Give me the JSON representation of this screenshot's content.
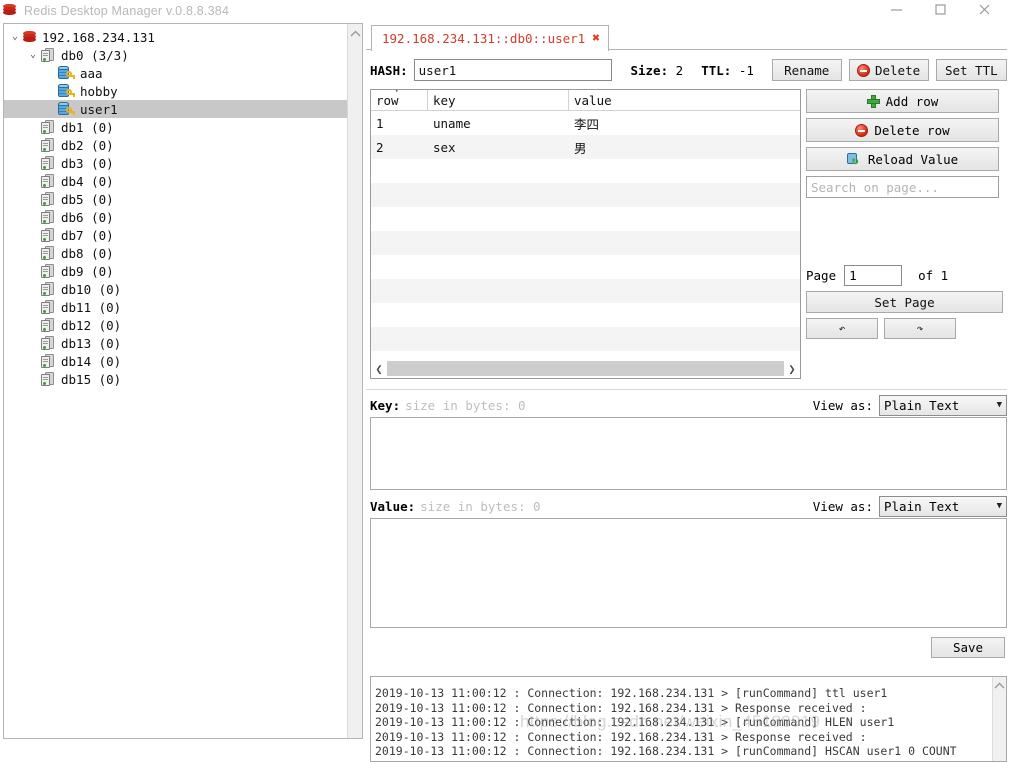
{
  "window": {
    "title": "Redis Desktop Manager v.0.8.8.384",
    "logo_icon": "redis-logo-icon",
    "controls": {
      "minimize": "minimize-icon",
      "maximize": "maximize-icon",
      "close": "close-icon"
    }
  },
  "tree": {
    "nodes": [
      {
        "label": "192.168.234.131",
        "level": 1,
        "twist": "⌄",
        "icon": "redis-server-icon",
        "selected": false
      },
      {
        "label": "db0   (3/3)",
        "level": 2,
        "twist": "⌄",
        "icon": "database-icon",
        "selected": false
      },
      {
        "label": "aaa",
        "level": 3,
        "twist": "",
        "icon": "key-icon",
        "selected": false
      },
      {
        "label": "hobby",
        "level": 3,
        "twist": "",
        "icon": "key-icon",
        "selected": false
      },
      {
        "label": "user1",
        "level": 3,
        "twist": "",
        "icon": "key-icon",
        "selected": true
      },
      {
        "label": "db1  (0)",
        "level": 2,
        "twist": "",
        "icon": "database-icon",
        "selected": false
      },
      {
        "label": "db2  (0)",
        "level": 2,
        "twist": "",
        "icon": "database-icon",
        "selected": false
      },
      {
        "label": "db3  (0)",
        "level": 2,
        "twist": "",
        "icon": "database-icon",
        "selected": false
      },
      {
        "label": "db4  (0)",
        "level": 2,
        "twist": "",
        "icon": "database-icon",
        "selected": false
      },
      {
        "label": "db5  (0)",
        "level": 2,
        "twist": "",
        "icon": "database-icon",
        "selected": false
      },
      {
        "label": "db6  (0)",
        "level": 2,
        "twist": "",
        "icon": "database-icon",
        "selected": false
      },
      {
        "label": "db7  (0)",
        "level": 2,
        "twist": "",
        "icon": "database-icon",
        "selected": false
      },
      {
        "label": "db8  (0)",
        "level": 2,
        "twist": "",
        "icon": "database-icon",
        "selected": false
      },
      {
        "label": "db9  (0)",
        "level": 2,
        "twist": "",
        "icon": "database-icon",
        "selected": false
      },
      {
        "label": "db10  (0)",
        "level": 2,
        "twist": "",
        "icon": "database-icon",
        "selected": false
      },
      {
        "label": "db11  (0)",
        "level": 2,
        "twist": "",
        "icon": "database-icon",
        "selected": false
      },
      {
        "label": "db12  (0)",
        "level": 2,
        "twist": "",
        "icon": "database-icon",
        "selected": false
      },
      {
        "label": "db13  (0)",
        "level": 2,
        "twist": "",
        "icon": "database-icon",
        "selected": false
      },
      {
        "label": "db14  (0)",
        "level": 2,
        "twist": "",
        "icon": "database-icon",
        "selected": false
      },
      {
        "label": "db15  (0)",
        "level": 2,
        "twist": "",
        "icon": "database-icon",
        "selected": false
      }
    ],
    "scrollbar_up_icon": "chevron-up-icon"
  },
  "tabs": [
    {
      "label": "192.168.234.131::db0::user1",
      "close_icon": "close-tab-icon",
      "active": true
    }
  ],
  "key_toolbar": {
    "type_label": "HASH:",
    "key_value": "user1",
    "size_label": "Size:",
    "size_value": "2",
    "ttl_label": "TTL:",
    "ttl_value": "-1",
    "rename_label": "Rename",
    "delete_label": "Delete",
    "delete_icon": "minus-circle-red-icon",
    "set_ttl_label": "Set TTL"
  },
  "table": {
    "columns": [
      "row",
      "key",
      "value"
    ],
    "sort_caret_icon": "sort-caret-icon",
    "rows": [
      {
        "row": "1",
        "key": "uname",
        "value": "李四"
      },
      {
        "row": "2",
        "key": "sex",
        "value": "男"
      }
    ],
    "empty_row_count": 9,
    "hscroll": {
      "left_icon": "chevron-left-icon",
      "right_icon": "chevron-right-icon"
    }
  },
  "side_panel": {
    "add_row_label": "Add row",
    "add_row_icon": "plus-green-icon",
    "delete_row_label": "Delete row",
    "delete_row_icon": "minus-circle-red-icon",
    "reload_value_label": "Reload Value",
    "reload_value_icon": "reload-database-icon",
    "search_placeholder": "Search on page...",
    "search_value": "",
    "page_label": "Page",
    "page_value": "1",
    "of_label": "of 1",
    "set_page_label": "Set Page",
    "prev_page_icon": "arrow-left-icon",
    "next_page_icon": "arrow-right-icon"
  },
  "editors": {
    "key": {
      "label": "Key:",
      "size_text": "size in bytes: 0",
      "view_as_label": "View as:",
      "view_as_value": "Plain Text",
      "chevron_icon": "chevron-down-icon",
      "content": ""
    },
    "value": {
      "label": "Value:",
      "size_text": "size in bytes: 0",
      "view_as_label": "View as:",
      "view_as_value": "Plain Text",
      "chevron_icon": "chevron-down-icon",
      "content": ""
    },
    "save_label": "Save"
  },
  "log": {
    "scrollbar_up_icon": "chevron-up-icon",
    "lines": [
      "2019-10-13 11:00:12 : Connection: 192.168.234.131 > [runCommand] ttl user1",
      "2019-10-13 11:00:12 : Connection: 192.168.234.131 > Response received :",
      "2019-10-13 11:00:12 : Connection: 192.168.234.131 > [runCommand] HLEN user1",
      "2019-10-13 11:00:12 : Connection: 192.168.234.131 > Response received :",
      "2019-10-13 11:00:12 : Connection: 192.168.234.131 > [runCommand] HSCAN user1 0 COUNT"
    ]
  },
  "watermark": "https://blog.csdn.net/weixin_45180919",
  "colors": {
    "tab_text": "#d23b2b",
    "selection": "#c8c8c8",
    "accent_red": "#cc2b1e",
    "accent_green": "#3faa3f",
    "placeholder": "#b4b4b4"
  }
}
